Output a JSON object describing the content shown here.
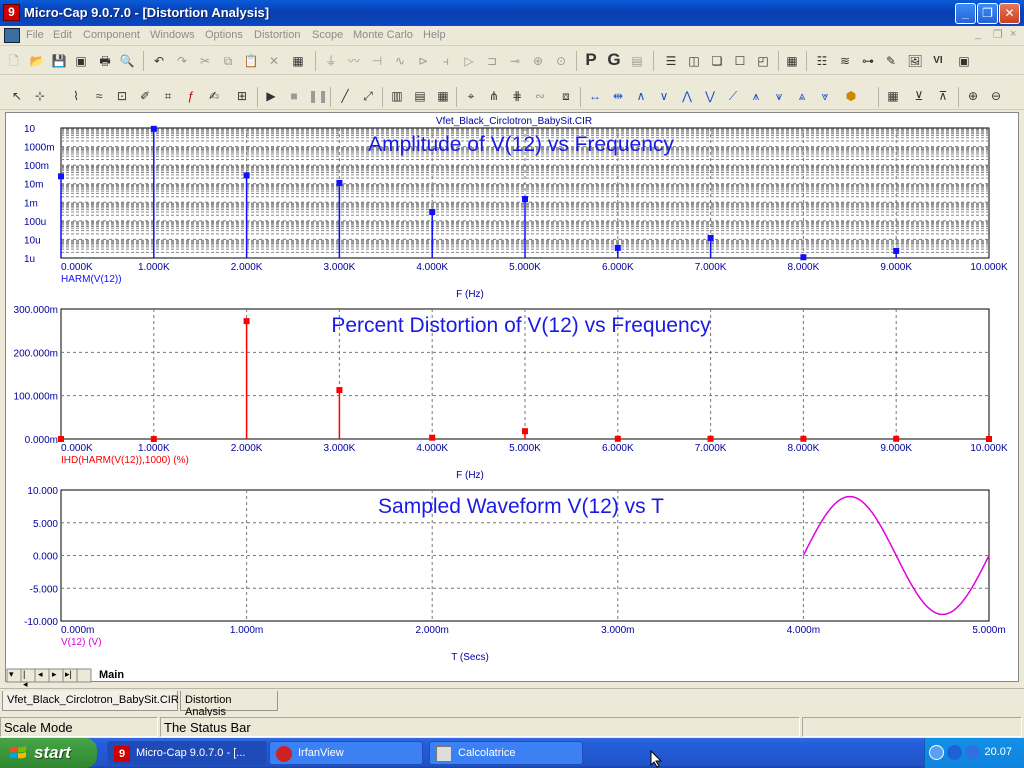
{
  "window": {
    "title": "Micro-Cap 9.0.7.0 - [Distortion Analysis]",
    "app_icon_glyph": "9",
    "controls": {
      "minimize": "_",
      "restore": "❐",
      "close": "✕"
    }
  },
  "menu": {
    "items": [
      "File",
      "Edit",
      "Component",
      "Windows",
      "Options",
      "Distortion",
      "Scope",
      "Monte Carlo",
      "Help"
    ],
    "mdi_controls": [
      "_",
      "❐",
      "×"
    ]
  },
  "toolbar1": {
    "buttons": [
      "new-icon",
      "open-icon",
      "save-icon",
      "save-all-icon",
      "print-icon",
      "print-preview-icon",
      "undo-icon",
      "redo-icon",
      "cut-icon",
      "copy-icon",
      "paste-icon",
      "delete-icon",
      "select-all-icon"
    ],
    "text_buttons": [
      "P",
      "G"
    ]
  },
  "plot": {
    "filename": "Vfet_Black_Circlotron_BabySit.CIR",
    "colors": {
      "amplitude": "#1010ff",
      "distortion": "#ff0000",
      "waveform": "#e000e0",
      "title": "#1a1ae6",
      "axis_text": "#0000a0"
    }
  },
  "chart_data": [
    {
      "type": "bar",
      "title": "Amplitude of V(12) vs Frequency",
      "xlabel": "F (Hz)",
      "ylabel": "HARM(V(12))",
      "yscale": "log",
      "x_ticks": [
        "0.000K",
        "1.000K",
        "2.000K",
        "3.000K",
        "4.000K",
        "5.000K",
        "6.000K",
        "7.000K",
        "8.000K",
        "9.000K",
        "10.000K"
      ],
      "y_ticks": [
        "10",
        "1000m",
        "100m",
        "10m",
        "1m",
        "100u",
        "10u",
        "1u"
      ],
      "xlim": [
        0,
        10000
      ],
      "ylim": [
        1e-06,
        10
      ],
      "x": [
        0,
        1000,
        2000,
        3000,
        4000,
        5000,
        6000,
        7000,
        8000,
        9000
      ],
      "values": [
        0.025,
        9.0,
        0.028,
        0.011,
        0.0003,
        0.0015,
        3.5e-06,
        1.2e-05,
        1.1e-06,
        2.4e-06
      ],
      "grid": true
    },
    {
      "type": "bar",
      "title": "Percent Distortion of V(12) vs Frequency",
      "xlabel": "F (Hz)",
      "ylabel": "IHD(HARM(V(12)),1000) (%)",
      "x_ticks": [
        "0.000K",
        "1.000K",
        "2.000K",
        "3.000K",
        "4.000K",
        "5.000K",
        "6.000K",
        "7.000K",
        "8.000K",
        "9.000K",
        "10.000K"
      ],
      "y_ticks": [
        "300.000m",
        "200.000m",
        "100.000m",
        "0.000m"
      ],
      "xlim": [
        0,
        10000
      ],
      "ylim": [
        0,
        0.3
      ],
      "x": [
        0,
        1000,
        2000,
        3000,
        4000,
        5000,
        6000,
        7000,
        8000,
        9000,
        10000
      ],
      "values": [
        0,
        0,
        0.272,
        0.113,
        0.003,
        0.018,
        0.0005,
        0.0005,
        0.0005,
        0.0005,
        0
      ],
      "grid": true
    },
    {
      "type": "line",
      "title": "Sampled Waveform  V(12) vs T",
      "xlabel": "T (Secs)",
      "ylabel": "V(12) (V)",
      "x_ticks": [
        "0.000m",
        "1.000m",
        "2.000m",
        "3.000m",
        "4.000m",
        "5.000m"
      ],
      "y_ticks": [
        "10.000",
        "5.000",
        "0.000",
        "-5.000",
        "-10.000"
      ],
      "xlim": [
        0,
        0.005
      ],
      "ylim": [
        -10,
        10
      ],
      "series": [
        {
          "amplitude": 9.0,
          "frequency_hz": 1000,
          "t_start": 0.004,
          "t_end": 0.005
        }
      ],
      "grid": true
    }
  ],
  "tabs": {
    "page_tab": "Main",
    "doc_tabs": [
      "Vfet_Black_Circlotron_BabySit.CIR",
      "Distortion Analysis"
    ]
  },
  "status": {
    "mode": "Scale Mode",
    "message": "The Status Bar"
  },
  "taskbar": {
    "start": "start",
    "tasks": [
      "Micro-Cap 9.0.7.0 - [...",
      "IrfanView",
      "Calcolatrice"
    ],
    "clock": "20.07"
  }
}
